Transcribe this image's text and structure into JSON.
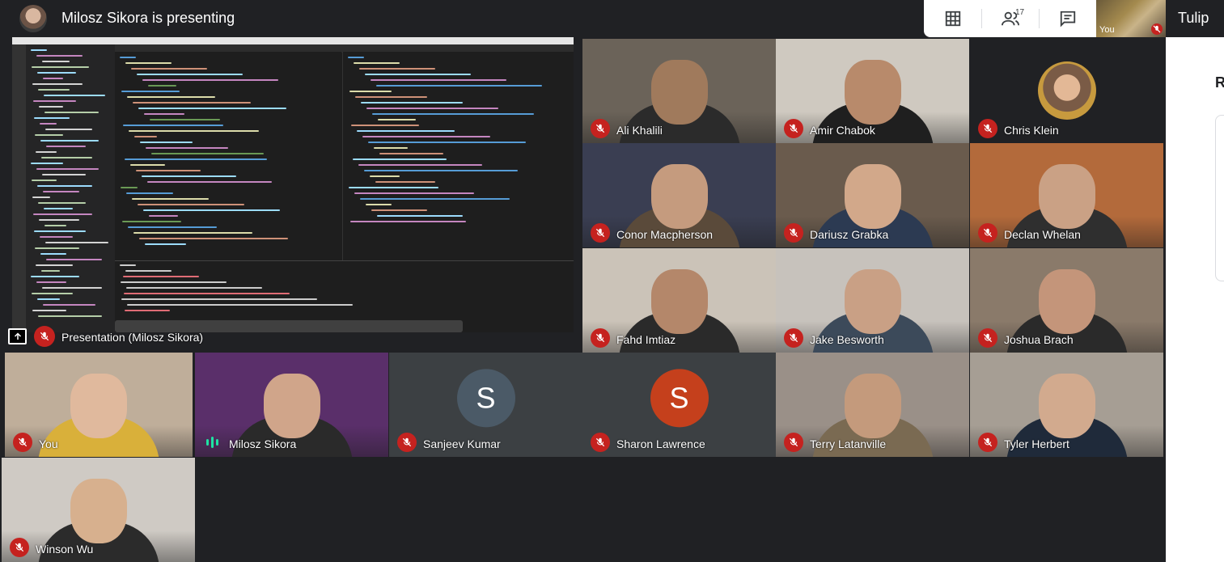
{
  "header": {
    "title": "Milosz Sikora is presenting",
    "participant_count": "17",
    "self_label": "You",
    "tab_label": "Tulip",
    "side_heading": "R"
  },
  "presentation": {
    "label": "Presentation (Milosz Sikora)"
  },
  "tiles": [
    {
      "name": "Ali Khalili",
      "muted": true,
      "bg": "#6b6359",
      "skin": "#a07a5c",
      "shirt": "#2b2b2b"
    },
    {
      "name": "Amir Chabok",
      "muted": true,
      "bg": "#cfc9c0",
      "skin": "#b88a6b",
      "shirt": "#1f1f1f"
    },
    {
      "name": "Chris Klein",
      "muted": true,
      "avatar": "photo"
    },
    {
      "name": "Conor Macpherson",
      "muted": true,
      "bg": "#3a3e52",
      "skin": "#c59b7e",
      "shirt": "#5a4a3a"
    },
    {
      "name": "Dariusz Grabka",
      "muted": true,
      "bg": "#6a5b4d",
      "skin": "#d2a88a",
      "shirt": "#2c3a52"
    },
    {
      "name": "Declan Whelan",
      "muted": true,
      "bg": "#b36a3b",
      "skin": "#caa185",
      "shirt": "#2f2f2f"
    },
    {
      "name": "Fahd Imtiaz",
      "muted": true,
      "bg": "#cbc3b8",
      "skin": "#b4876a",
      "shirt": "#2a2a2a"
    },
    {
      "name": "Jake Besworth",
      "muted": true,
      "bg": "#c7c2bc",
      "skin": "#c9a085",
      "shirt": "#3c4a5a"
    },
    {
      "name": "Joshua Brach",
      "muted": true,
      "bg": "#8a7a6a",
      "skin": "#c4957a",
      "shirt": "#2a2a2a"
    },
    {
      "name": "You",
      "muted": true,
      "bg": "#bfae9a",
      "skin": "#e0b99d",
      "shirt": "#d9b03a"
    },
    {
      "name": "Milosz Sikora",
      "muted": false,
      "bg": "#5a2f6a",
      "skin": "#d0a58a",
      "shirt": "#2a2a2a"
    },
    {
      "name": "Sanjeev Kumar",
      "muted": true,
      "avatar": "letter",
      "letter": "S",
      "avatar_color": "#4b5a67"
    },
    {
      "name": "Sharon Lawrence",
      "muted": true,
      "avatar": "letter",
      "letter": "S",
      "avatar_color": "#c5401c"
    },
    {
      "name": "Terry Latanville",
      "muted": true,
      "bg": "#9a9088",
      "skin": "#c49a7c",
      "shirt": "#7a6a52"
    },
    {
      "name": "Tyler Herbert",
      "muted": true,
      "bg": "#a69e94",
      "skin": "#d2aa8e",
      "shirt": "#1f2a3a"
    },
    {
      "name": "Winson Wu",
      "muted": true,
      "bg": "#cfcac4",
      "skin": "#d7b08e",
      "shirt": "#2b2b2b"
    }
  ],
  "colors": {
    "background": "#202124",
    "mute_red": "#c5221f",
    "speaking_green": "#1ee3a3"
  }
}
